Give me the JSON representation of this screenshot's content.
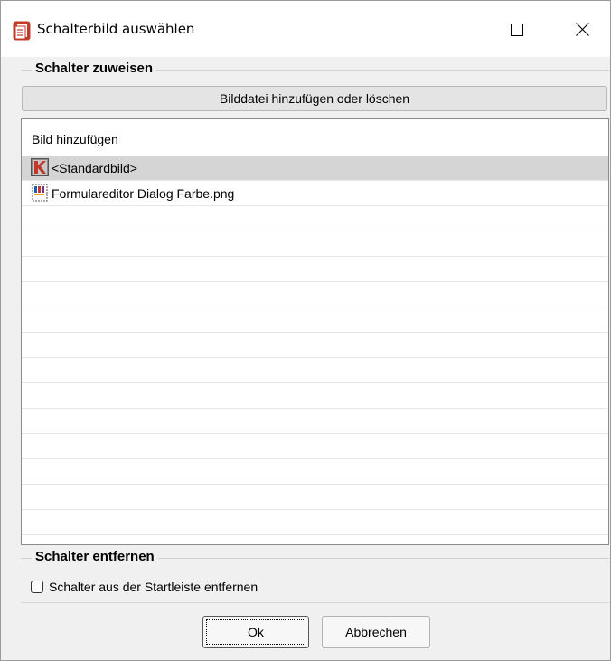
{
  "window": {
    "title": "Schalterbild auswählen",
    "icons": {
      "app": "document-stack-icon",
      "maximize": "maximize-icon",
      "close": "close-icon"
    }
  },
  "assign_section": {
    "title": "Schalter zuweisen",
    "button_label": "Bilddatei hinzufügen oder löschen",
    "list": {
      "header": "Bild hinzufügen",
      "items": [
        {
          "label": "<Standardbild>",
          "icon": "standard-image-icon",
          "selected": true
        },
        {
          "label": "Formulareditor Dialog Farbe.png",
          "icon": "png-image-icon",
          "selected": false
        }
      ]
    }
  },
  "remove_section": {
    "title": "Schalter entfernen",
    "checkbox_label": "Schalter aus der Startleiste entfernen",
    "checked": false
  },
  "footer": {
    "ok_label": "Ok",
    "cancel_label": "Abbrechen"
  },
  "colors": {
    "selection": "#d5d5d5",
    "app_icon": "#c0392b"
  }
}
